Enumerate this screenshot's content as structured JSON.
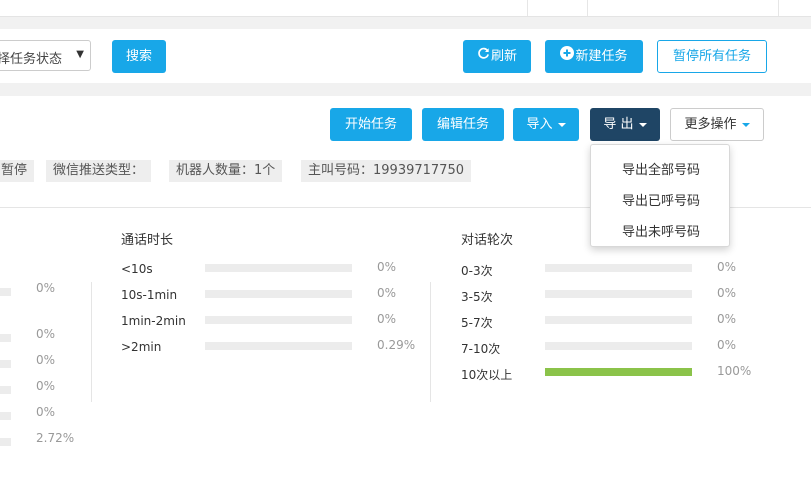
{
  "filter": {
    "status_select": "择任务状态",
    "search_label": "搜索",
    "refresh_label": "刷新",
    "new_task_label": "新建任务",
    "pause_all_label": "暂停所有任务"
  },
  "toolbar": {
    "start_label": "开始任务",
    "edit_label": "编辑任务",
    "import_label": "导入",
    "export_label": "导 出",
    "more_label": "更多操作"
  },
  "export_menu": [
    "导出全部号码",
    "导出已呼号码",
    "导出未呼号码"
  ],
  "info_tags": {
    "status": "暂停",
    "wechat_type": "微信推送类型：",
    "robot_count": "机器人数量：1个",
    "caller_number": "主叫号码：19939717750"
  },
  "left_stats": {
    "percents": [
      "0%",
      "0%",
      "0%",
      "0%",
      "0%",
      "2.72%"
    ]
  },
  "call_duration": {
    "title": "通话时长",
    "rows": [
      {
        "label": "<10s",
        "percent": "0%",
        "value": 0
      },
      {
        "label": "10s-1min",
        "percent": "0%",
        "value": 0
      },
      {
        "label": "1min-2min",
        "percent": "0%",
        "value": 0
      },
      {
        "label": ">2min",
        "percent": "0.29%",
        "value": 0.29
      }
    ]
  },
  "dialog_rounds": {
    "title": "对话轮次",
    "rows": [
      {
        "label": "0-3次",
        "percent": "0%",
        "value": 0
      },
      {
        "label": "3-5次",
        "percent": "0%",
        "value": 0
      },
      {
        "label": "5-7次",
        "percent": "0%",
        "value": 0
      },
      {
        "label": "7-10次",
        "percent": "0%",
        "value": 0
      },
      {
        "label": "10次以上",
        "percent": "100%",
        "value": 100
      }
    ]
  },
  "colors": {
    "primary": "#18a7e8",
    "dark_button": "#1f4565",
    "bar_fill": "#8bc34a",
    "bar_track": "#ececec"
  }
}
